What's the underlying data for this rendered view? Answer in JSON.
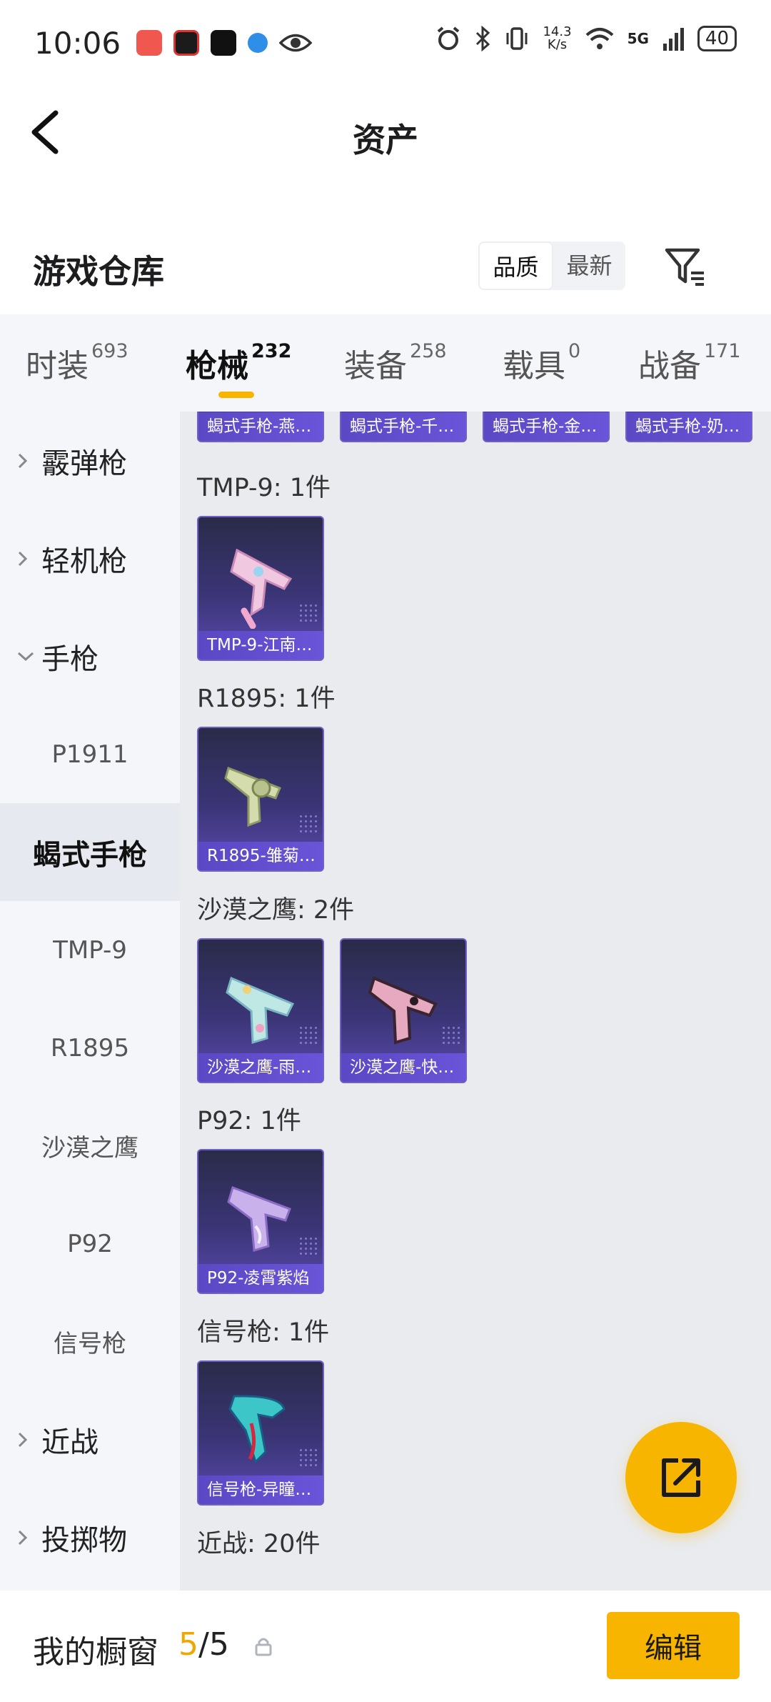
{
  "status_bar": {
    "time": "10:06",
    "net_speed_value": "14.3",
    "net_speed_unit": "K/s",
    "network": "5G",
    "battery": "40"
  },
  "header": {
    "title": "资产"
  },
  "warehouse": {
    "title": "游戏仓库",
    "sort_options": [
      "品质",
      "最新"
    ],
    "active_sort": "品质"
  },
  "tabs": [
    {
      "label": "时装",
      "count": "693"
    },
    {
      "label": "枪械",
      "count": "232"
    },
    {
      "label": "装备",
      "count": "258"
    },
    {
      "label": "载具",
      "count": "0"
    },
    {
      "label": "战备",
      "count": "171"
    }
  ],
  "active_tab": "枪械",
  "sidebar": {
    "items": [
      {
        "label": "霰弹枪",
        "kind": "group",
        "expanded": false
      },
      {
        "label": "轻机枪",
        "kind": "group",
        "expanded": false
      },
      {
        "label": "手枪",
        "kind": "group",
        "expanded": true
      },
      {
        "label": "P1911",
        "kind": "sub"
      },
      {
        "label": "蝎式手枪",
        "kind": "sub",
        "selected": true
      },
      {
        "label": "TMP-9",
        "kind": "sub"
      },
      {
        "label": "R1895",
        "kind": "sub"
      },
      {
        "label": "沙漠之鹰",
        "kind": "sub"
      },
      {
        "label": "P92",
        "kind": "sub"
      },
      {
        "label": "信号枪",
        "kind": "sub"
      },
      {
        "label": "近战",
        "kind": "group",
        "expanded": false
      },
      {
        "label": "投掷物",
        "kind": "group",
        "expanded": false
      }
    ]
  },
  "content": {
    "partial_row": [
      "蝎式手枪-燕…",
      "蝎式手枪-千…",
      "蝎式手枪-金…",
      "蝎式手枪-奶…"
    ],
    "sections": [
      {
        "label": "TMP-9: 1件",
        "items": [
          "TMP-9-江南…"
        ]
      },
      {
        "label": "R1895: 1件",
        "items": [
          "R1895-雏菊…"
        ]
      },
      {
        "label": "沙漠之鹰: 2件",
        "items": [
          "沙漠之鹰-雨…",
          "沙漠之鹰-快…"
        ]
      },
      {
        "label": "P92: 1件",
        "items": [
          "P92-凌霄紫焰"
        ]
      },
      {
        "label": "信号枪: 1件",
        "items": [
          "信号枪-异瞳…"
        ]
      },
      {
        "label": "近战: 20件",
        "items": []
      }
    ]
  },
  "bottom_bar": {
    "showcase_label": "我的橱窗",
    "used": "5",
    "total": "5",
    "edit_label": "编辑"
  },
  "colors": {
    "accent": "#f7b500",
    "card_bg": "#3b3577",
    "card_caption": "#6a54d8"
  }
}
